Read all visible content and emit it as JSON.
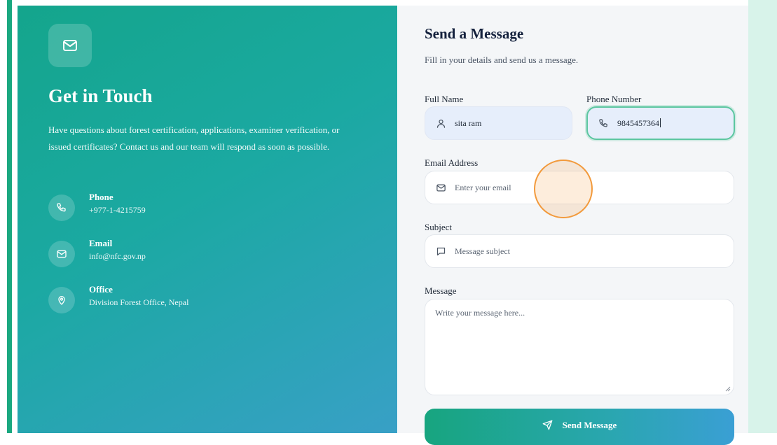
{
  "contact_info": {
    "title": "Get in Touch",
    "description": "Have questions about forest certification, applications, examiner verification, or issued certificates? Contact us and our team will respond as soon as possible.",
    "items": [
      {
        "label": "Phone",
        "value": "+977-1-4215759",
        "icon": "phone-icon"
      },
      {
        "label": "Email",
        "value": "info@nfc.gov.np",
        "icon": "mail-icon"
      },
      {
        "label": "Office",
        "value": "Division Forest Office, Nepal",
        "icon": "map-pin-icon"
      }
    ]
  },
  "form": {
    "title": "Send a Message",
    "subtitle": "Fill in your details and send us a message.",
    "full_name": {
      "label": "Full Name",
      "value": "sita ram",
      "icon": "user-icon"
    },
    "phone": {
      "label": "Phone Number",
      "value": "9845457364",
      "icon": "phone-icon",
      "focused": true
    },
    "email": {
      "label": "Email Address",
      "placeholder": "Enter your email",
      "icon": "mail-icon"
    },
    "subject": {
      "label": "Subject",
      "placeholder": "Message subject",
      "icon": "message-square-icon"
    },
    "message": {
      "label": "Message",
      "placeholder": "Write your message here..."
    },
    "submit_label": "Send Message",
    "submit_icon": "send-icon"
  },
  "colors": {
    "accent_green": "#1aa880",
    "accent_blue": "#3a9fd4",
    "focus_ring": "#5cc6a0",
    "cursor_highlight": "#f29a3c",
    "side_strip": "#d8f3ea"
  }
}
